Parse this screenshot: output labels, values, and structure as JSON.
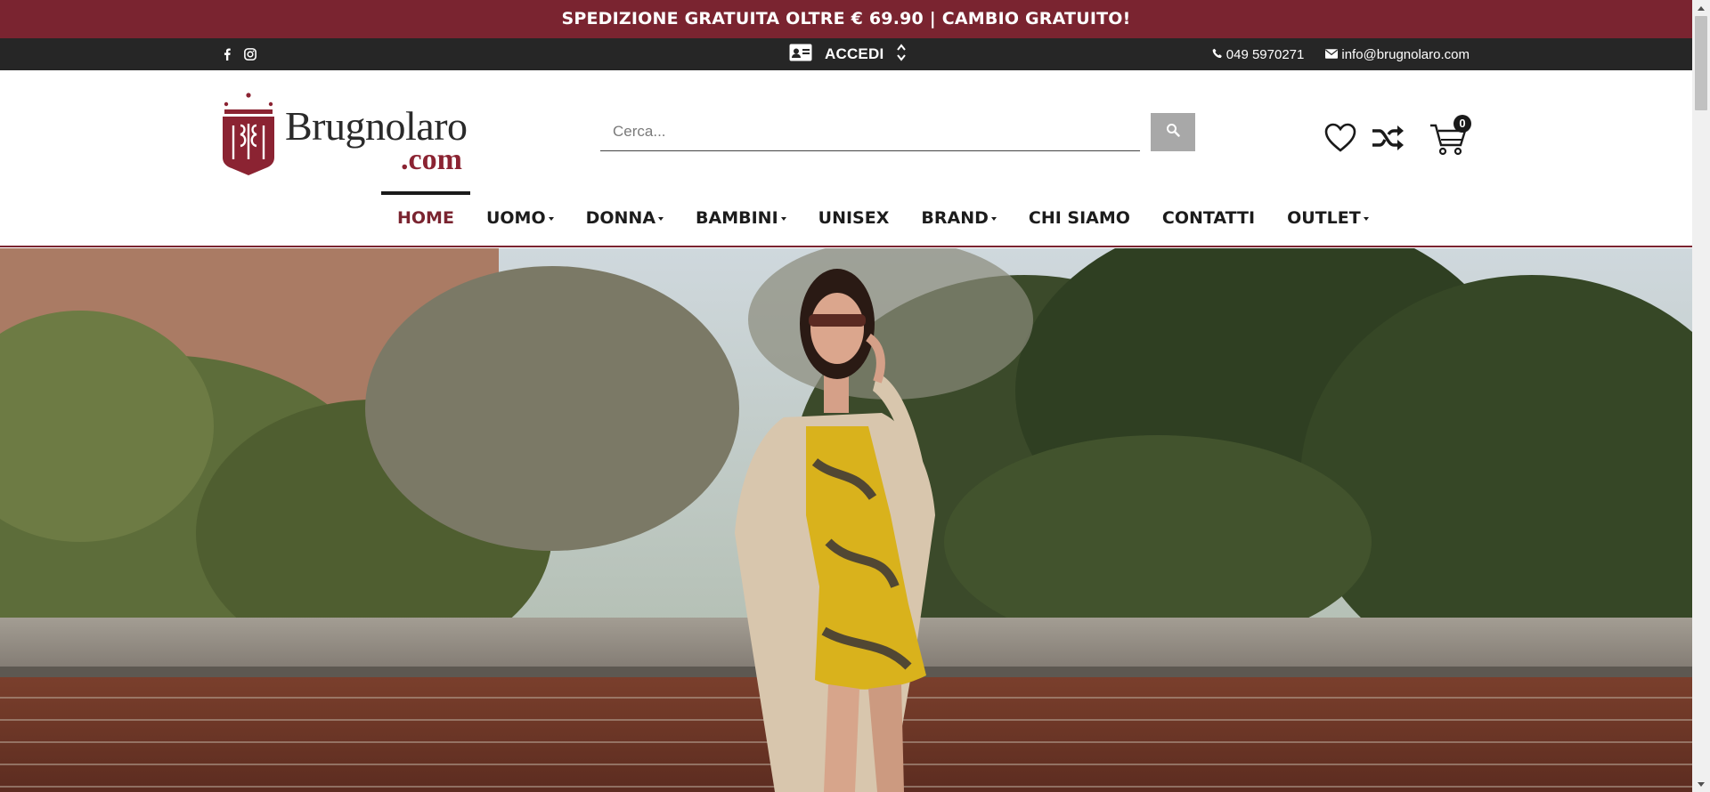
{
  "promo": {
    "text": "SPEDIZIONE GRATUITA OLTRE € 69.90 | CAMBIO GRATUITO!"
  },
  "topbar": {
    "social": [
      {
        "icon": "facebook-icon"
      },
      {
        "icon": "instagram-icon"
      }
    ],
    "login": {
      "label": "ACCEDI",
      "icon": "id-card-icon"
    },
    "phone": "049 5970271",
    "email": "info@brugnolaro.com"
  },
  "header": {
    "logo": {
      "name": "Brugnolaro",
      "suffix": ".com"
    },
    "search": {
      "placeholder": "Cerca...",
      "value": ""
    },
    "icons": [
      "heart-icon",
      "shuffle-icon",
      "cart-icon"
    ],
    "cart_count": "0"
  },
  "nav": {
    "items": [
      {
        "label": "HOME",
        "has_dropdown": false,
        "active": true
      },
      {
        "label": "UOMO",
        "has_dropdown": true
      },
      {
        "label": "DONNA",
        "has_dropdown": true
      },
      {
        "label": "BAMBINI",
        "has_dropdown": true
      },
      {
        "label": "UNISEX",
        "has_dropdown": false
      },
      {
        "label": "BRAND",
        "has_dropdown": true
      },
      {
        "label": "CHI SIAMO",
        "has_dropdown": false
      },
      {
        "label": "CONTATTI",
        "has_dropdown": false
      },
      {
        "label": "OUTLET",
        "has_dropdown": true
      }
    ]
  },
  "colors": {
    "brand": "#7a2430",
    "topbar": "#262626",
    "search_button": "#a8a8a8"
  }
}
